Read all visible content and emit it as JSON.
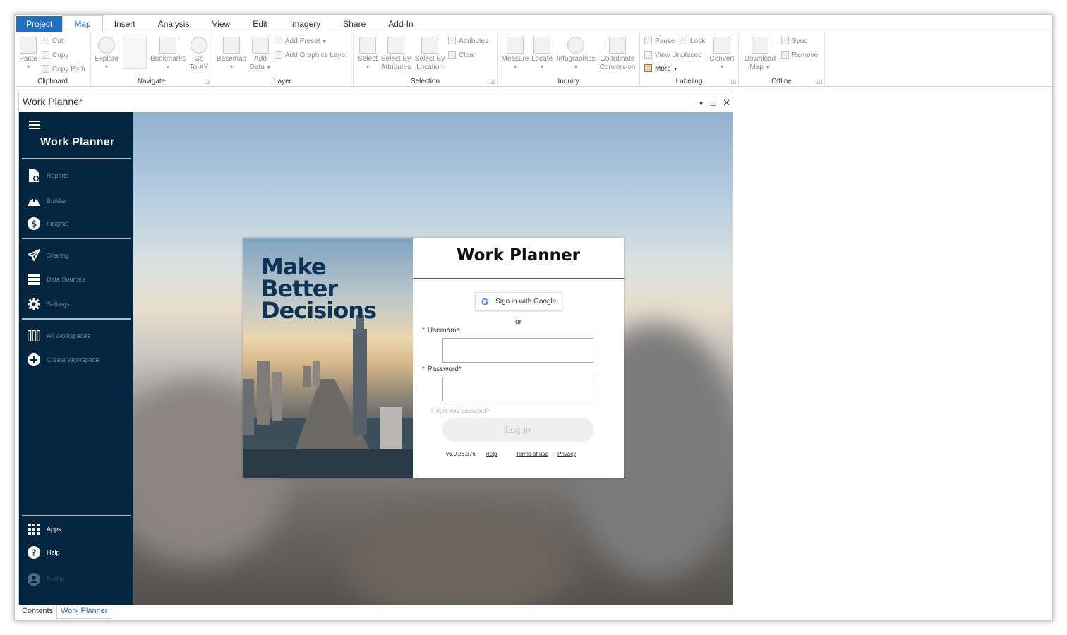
{
  "ribbon_tabs": [
    "Project",
    "Map",
    "Insert",
    "Analysis",
    "View",
    "Edit",
    "Imagery",
    "Share",
    "Add-In"
  ],
  "clipboard": {
    "paste": "Paste",
    "cut": "Cut",
    "copy": "Copy",
    "copy_path": "Copy Path",
    "label": "Clipboard"
  },
  "navigate": {
    "explore": "Explore",
    "bookmarks": "Bookmarks",
    "go": "Go",
    "to_xy": "To XY",
    "label": "Navigate"
  },
  "layer": {
    "basemap": "Basemap",
    "add": "Add",
    "data": "Data",
    "add_preset": "Add Preset",
    "add_graphics_layer": "Add Graphics Layer",
    "label": "Layer"
  },
  "selection": {
    "select": "Select",
    "select_by": "Select By",
    "attributes": "Attributes",
    "select_by2": "Select By",
    "location": "Location",
    "attributes_btn": "Attributes",
    "clear": "Clear",
    "label": "Selection"
  },
  "inquiry": {
    "measure": "Measure",
    "locate": "Locate",
    "infographics": "Infographics",
    "coordinate": "Coordinate",
    "conversion": "Conversion",
    "label": "Inquiry"
  },
  "labeling": {
    "pause": "Pause",
    "lock": "Lock",
    "view_unplaced": "View Unplaced",
    "more": "More",
    "convert": "Convert",
    "label": "Labeling"
  },
  "offline": {
    "download": "Download",
    "map": "Map",
    "sync": "Sync",
    "remove": "Remove",
    "label": "Offline"
  },
  "pane": {
    "title": "Work Planner"
  },
  "sidebar": {
    "title": "Work Planner",
    "items": [
      {
        "label": "Reports"
      },
      {
        "label": "Builder"
      },
      {
        "label": "Insights"
      },
      {
        "label": "Sharing"
      },
      {
        "label": "Data Sources"
      },
      {
        "label": "Settings"
      },
      {
        "label": "All Workspaces"
      },
      {
        "label": "Create Workspace"
      },
      {
        "label": "Apps"
      },
      {
        "label": "Help"
      },
      {
        "label": "Profile"
      }
    ]
  },
  "promo": {
    "line1": "Make",
    "line2": "Better",
    "line3": "Decisions"
  },
  "login": {
    "title": "Work Planner",
    "google_button": "Sign in with Google",
    "or": "or",
    "username_label": "Username",
    "username_value": "",
    "password_label": "Password*",
    "password_value": "",
    "forgot": "Forgot your password?",
    "login_button": "Log-in",
    "version": "v6.0.26.376",
    "help": "Help",
    "terms": "Terms of use",
    "privacy": "Privacy"
  },
  "bottom_tabs": [
    "Contents",
    "Work Planner"
  ],
  "colors": {
    "accent": "#1f6fc3",
    "sidebar": "#02263f",
    "required": "#d9262c"
  }
}
